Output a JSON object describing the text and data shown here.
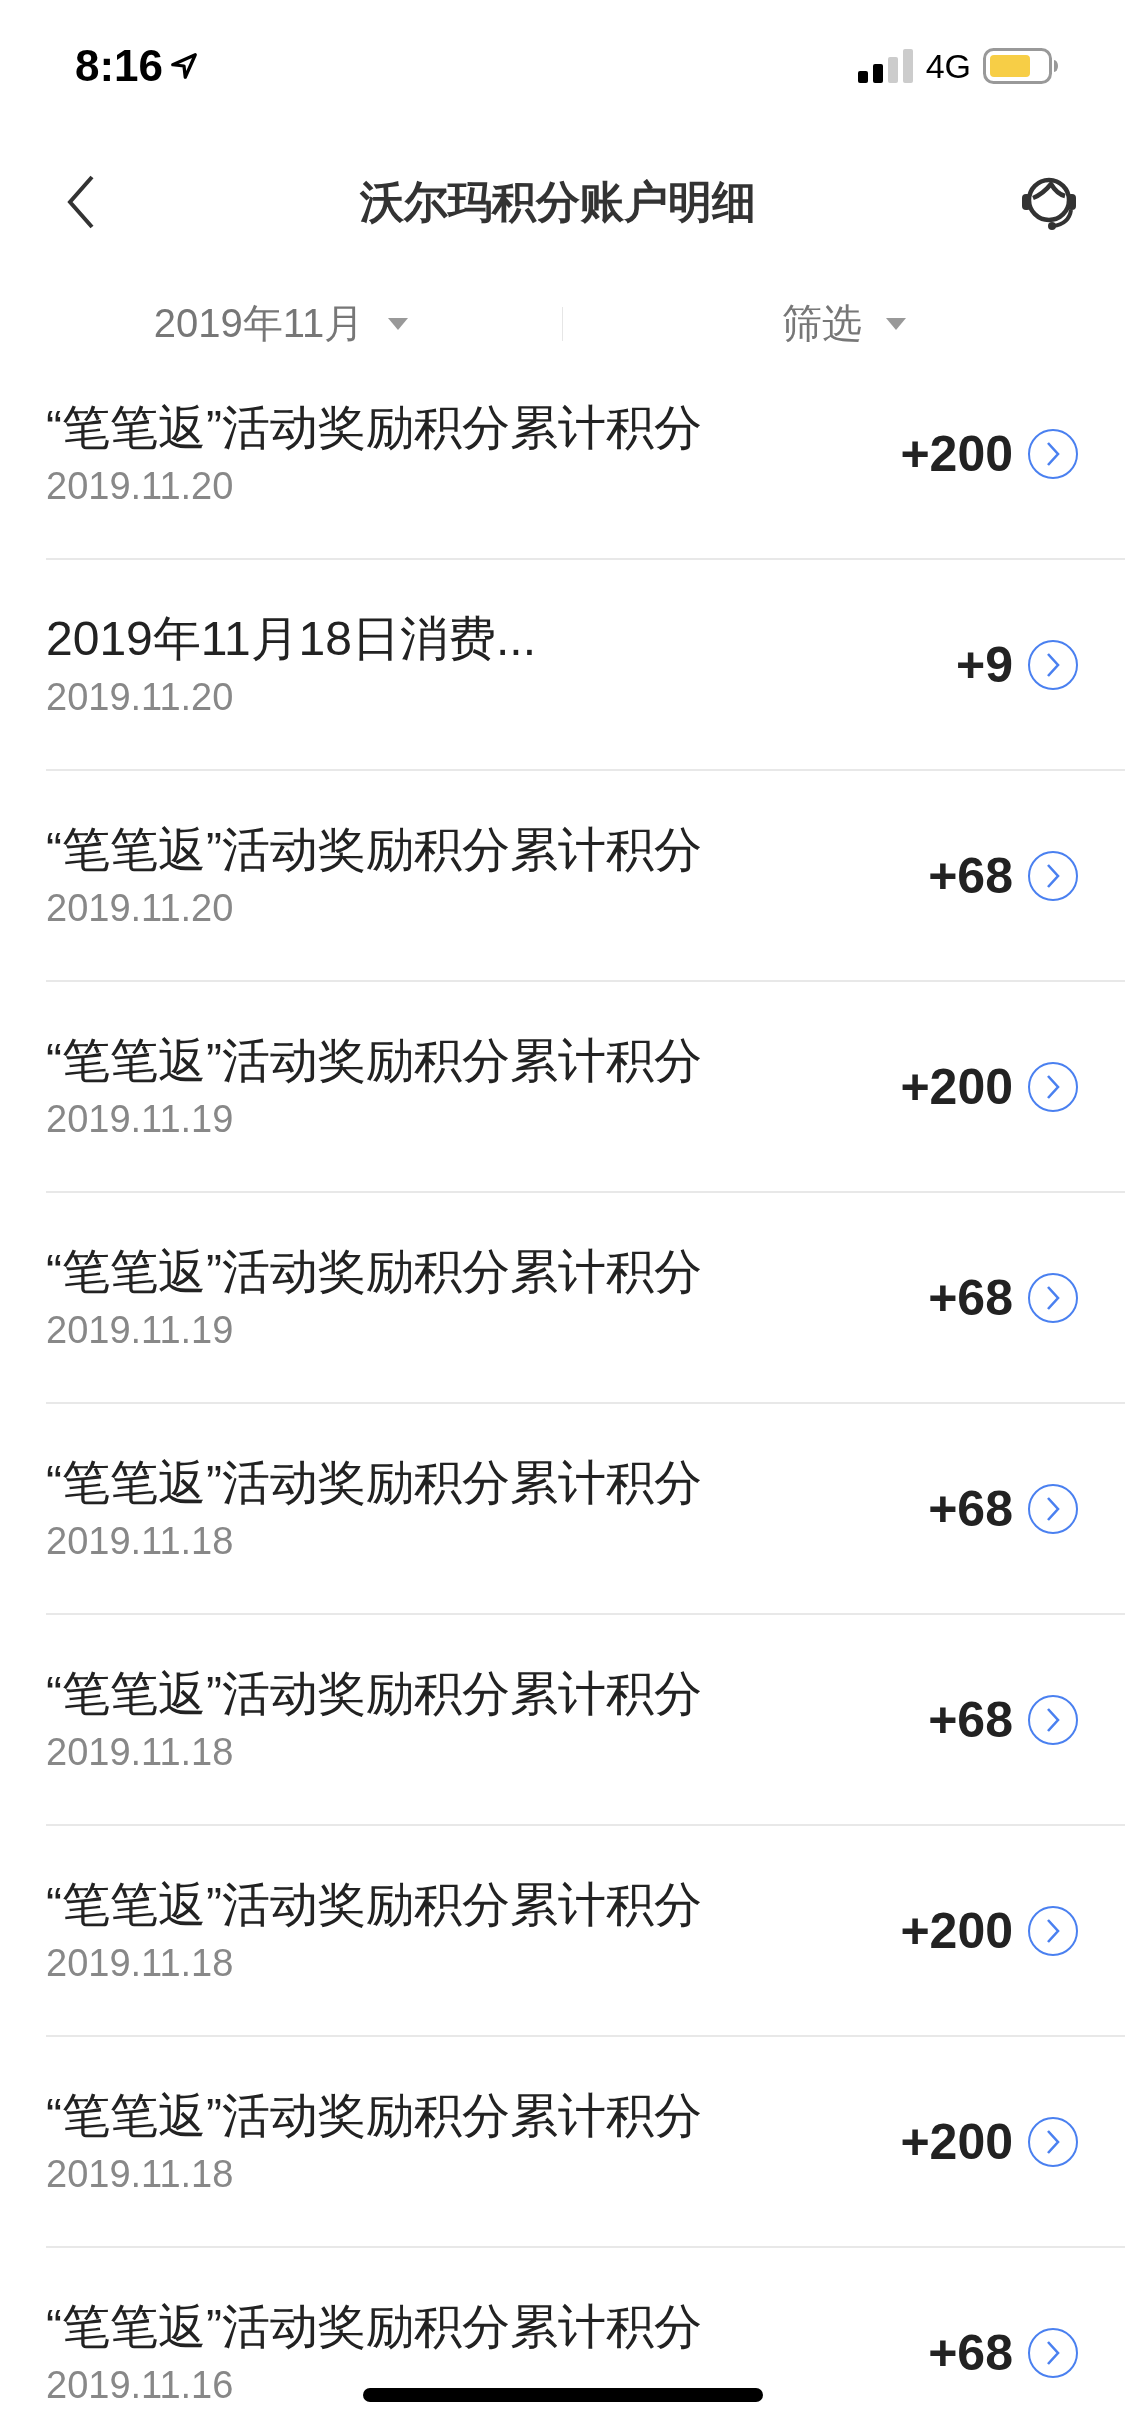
{
  "status_bar": {
    "time": "8:16",
    "network": "4G"
  },
  "nav": {
    "title": "沃尔玛积分账户明细"
  },
  "filters": [
    {
      "label": "2019年11月"
    },
    {
      "label": "筛选"
    }
  ],
  "records": [
    {
      "title": "“笔笔返”活动奖励积分累计积分",
      "date": "2019.11.20",
      "amount": "+200"
    },
    {
      "title": "2019年11月18日消费...",
      "date": "2019.11.20",
      "amount": "+9"
    },
    {
      "title": "“笔笔返”活动奖励积分累计积分",
      "date": "2019.11.20",
      "amount": "+68"
    },
    {
      "title": "“笔笔返”活动奖励积分累计积分",
      "date": "2019.11.19",
      "amount": "+200"
    },
    {
      "title": "“笔笔返”活动奖励积分累计积分",
      "date": "2019.11.19",
      "amount": "+68"
    },
    {
      "title": "“笔笔返”活动奖励积分累计积分",
      "date": "2019.11.18",
      "amount": "+68"
    },
    {
      "title": "“笔笔返”活动奖励积分累计积分",
      "date": "2019.11.18",
      "amount": "+68"
    },
    {
      "title": "“笔笔返”活动奖励积分累计积分",
      "date": "2019.11.18",
      "amount": "+200"
    },
    {
      "title": "“笔笔返”活动奖励积分累计积分",
      "date": "2019.11.18",
      "amount": "+200"
    },
    {
      "title": "“笔笔返”活动奖励积分累计积分",
      "date": "2019.11.16",
      "amount": "+68"
    }
  ]
}
